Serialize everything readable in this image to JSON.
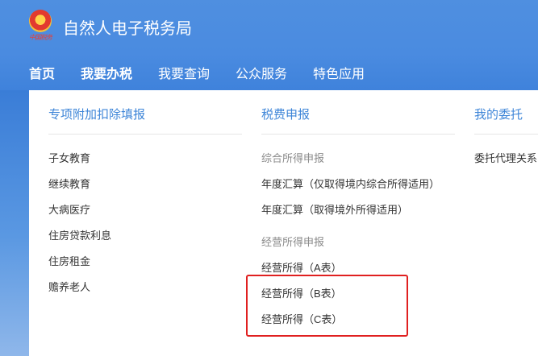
{
  "header": {
    "emblem_text": "中国税务",
    "title": "自然人电子税务局"
  },
  "nav": [
    {
      "label": "首页"
    },
    {
      "label": "我要办税"
    },
    {
      "label": "我要查询"
    },
    {
      "label": "公众服务"
    },
    {
      "label": "特色应用"
    }
  ],
  "menu": {
    "col1": {
      "title": "专项附加扣除填报",
      "items": [
        "子女教育",
        "继续教育",
        "大病医疗",
        "住房贷款利息",
        "住房租金",
        "赡养老人"
      ]
    },
    "col2": {
      "title": "税费申报",
      "group1_title": "综合所得申报",
      "group1_items": [
        "年度汇算（仅取得境内综合所得适用）",
        "年度汇算（取得境外所得适用）"
      ],
      "group2_title": "经营所得申报",
      "group2_items": [
        "经营所得（A表）",
        "经营所得（B表）",
        "经营所得（C表）"
      ]
    },
    "col3": {
      "title": "我的委托",
      "items": [
        "委托代理关系"
      ]
    }
  },
  "colors": {
    "header_blue": "#4a8be0",
    "link_blue": "#3f86d8",
    "highlight_red": "#e02020"
  }
}
